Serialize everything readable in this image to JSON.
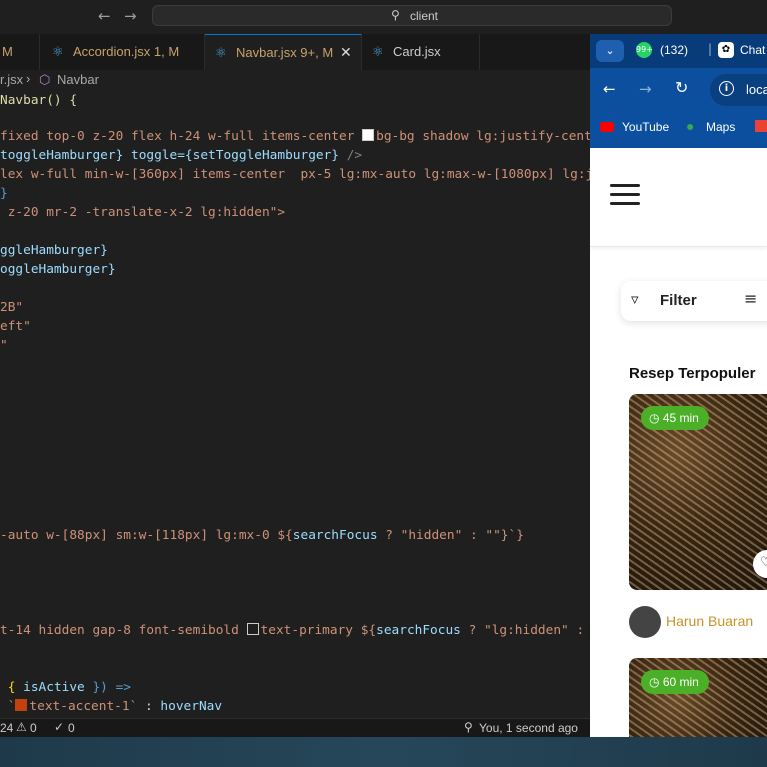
{
  "window": {
    "search": "client"
  },
  "tabs": [
    {
      "label": "M"
    },
    {
      "label": "Accordion.jsx 1, M"
    },
    {
      "label": "Navbar.jsx 9+, M"
    },
    {
      "label": "Card.jsx"
    }
  ],
  "breadcrumb": {
    "file": "r.jsx",
    "symbol": "Navbar"
  },
  "code": {
    "l1": "Navbar() {",
    "l2a": "fixed top-0 z-20 flex h-24 w-full items-center ",
    "l2b": "bg-bg shadow lg:justify-cent",
    "l3a": "toggleHamburger}",
    "l3b": " toggle=",
    "l3c": "{setToggleHamburger}",
    "l3d": " />",
    "l4": "lex w-full min-w-[360px] items-center  px-5 lg:mx-auto lg:max-w-[1080px] lg:j",
    "l5": "}",
    "l6": " z-20 mr-2 -translate-x-2 lg:hidden\">",
    "l7": "ggleHamburger}",
    "l8": "oggleHamburger}",
    "l9": "2B\"",
    "l10": "eft\"",
    "l11": "\"",
    "l12a": "-auto w-[88px] sm:w-[118px] lg:mx-0 ${",
    "l12b": "searchFocus",
    "l12c": " ? \"hidden\" : \"\"}`}",
    "l13a": "t-14 hidden gap-8 font-semibold ",
    "l13b": "text-primary ${",
    "l13c": "searchFocus",
    "l13d": " ? \"lg:hidden\" :",
    "l14a": " { ",
    "l14b": "isActive",
    "l14c": " }) =>",
    "l15a": " `",
    "l15b": "text-accent-1`",
    "l15c": " : ",
    "l15d": "hoverNav"
  },
  "status": {
    "problems": "24",
    "warnings": "0",
    "ports": "0",
    "blame": "You, 1 second ago"
  },
  "browser": {
    "tabs": [
      {
        "label": "(132)"
      },
      {
        "label": "Chat"
      }
    ],
    "address": "loca",
    "bookmarks": [
      {
        "label": "YouTube"
      },
      {
        "label": "Maps"
      }
    ],
    "filter_label": "Filter",
    "section_title": "Resep Terpopuler",
    "cards": [
      {
        "time": "45 min",
        "author": "Harun Buaran"
      },
      {
        "time": "60 min"
      }
    ]
  },
  "colors": {
    "accent": "#0078d4",
    "browser_bar": "#0c4f9e",
    "time_chip": "#4caf28",
    "author": "#c8932a"
  }
}
